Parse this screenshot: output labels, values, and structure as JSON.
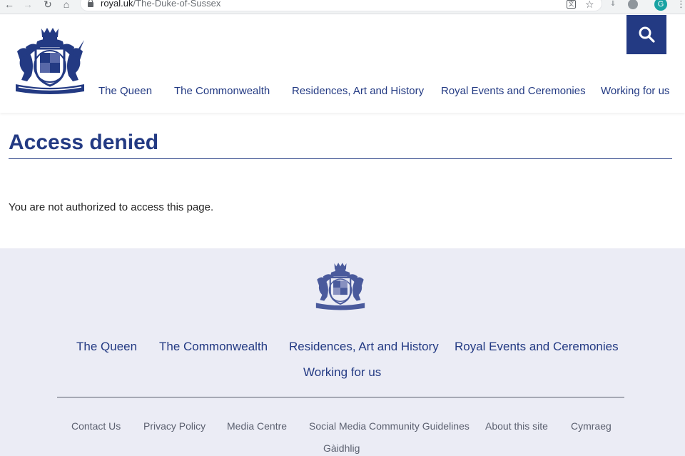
{
  "browser": {
    "domain": "royal.uk",
    "path": "/The-Duke-of-Sussex",
    "profile_initial": "G"
  },
  "header": {
    "nav": [
      {
        "label": "The Queen"
      },
      {
        "label": "The Commonwealth"
      },
      {
        "label": "Residences, Art and History"
      },
      {
        "label": "Royal Events and Ceremonies"
      },
      {
        "label": "Working for us"
      }
    ]
  },
  "main": {
    "title": "Access denied",
    "message": "You are not authorized to access this page."
  },
  "footer": {
    "nav": [
      {
        "label": "The Queen"
      },
      {
        "label": "The Commonwealth"
      },
      {
        "label": "Residences, Art and History"
      },
      {
        "label": "Royal Events and Ceremonies"
      },
      {
        "label": "Working for us"
      }
    ],
    "links": [
      {
        "label": "Contact Us"
      },
      {
        "label": "Privacy Policy"
      },
      {
        "label": "Media Centre"
      },
      {
        "label": "Social Media Community Guidelines"
      },
      {
        "label": "About this site"
      },
      {
        "label": "Cymraeg"
      },
      {
        "label": "Gàidhlig"
      }
    ]
  },
  "colors": {
    "brand_navy": "#233a83",
    "footer_bg": "#ebecf5",
    "footer_link_gray": "#5c6170"
  },
  "icons": {
    "search": "search-icon",
    "crest": "royal-coat-of-arms-icon"
  }
}
